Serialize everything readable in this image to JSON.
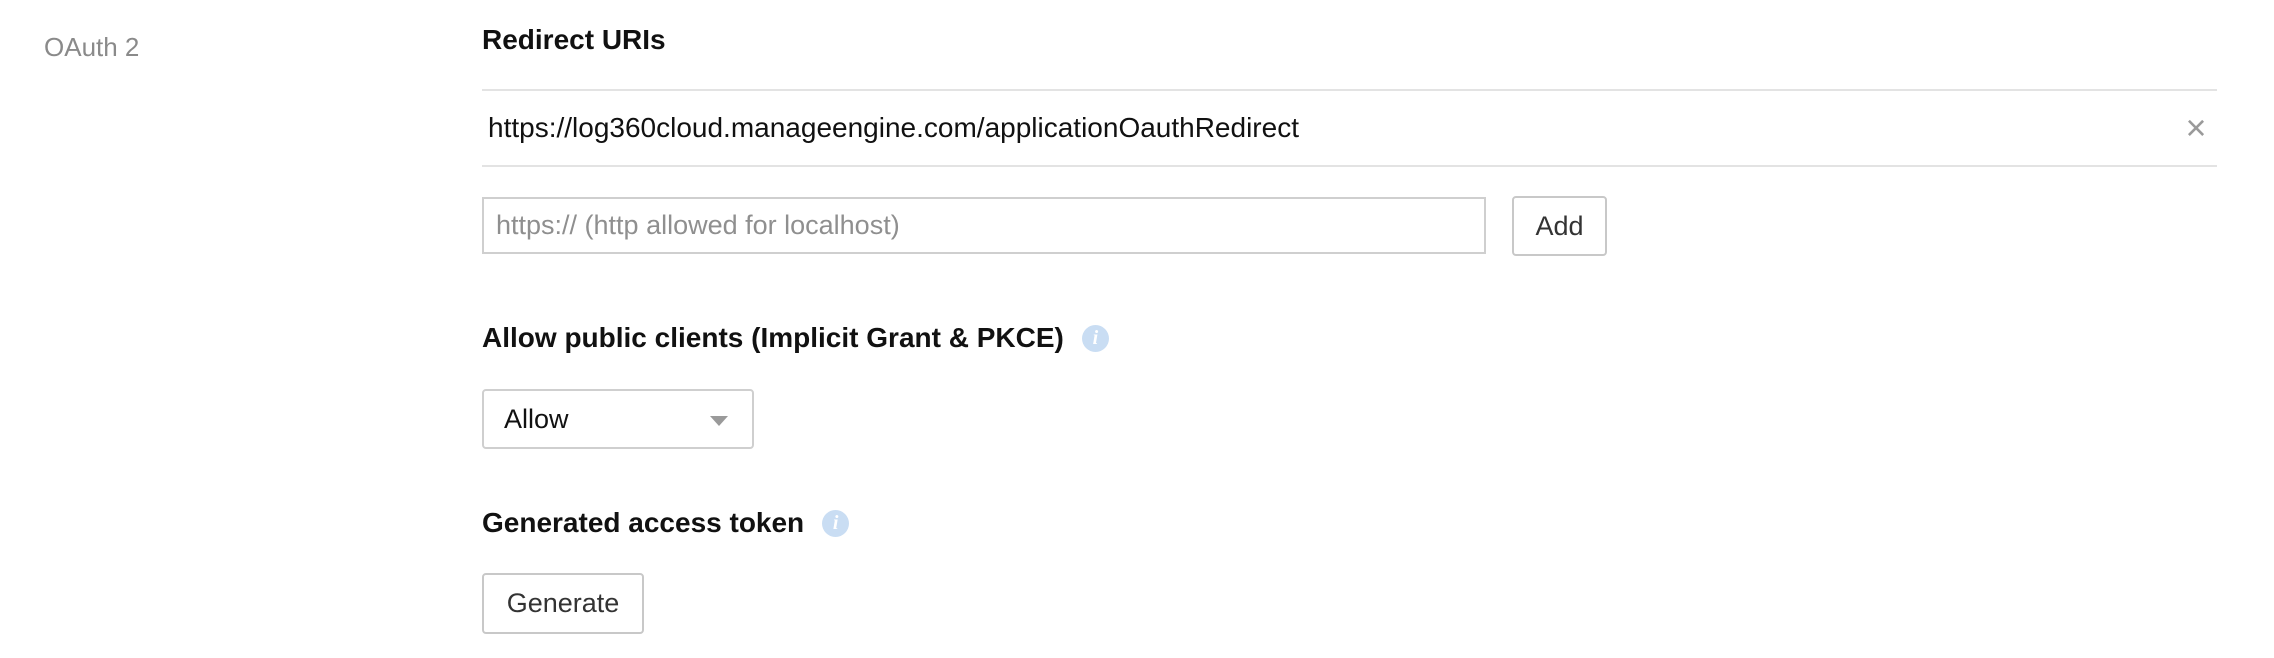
{
  "section": {
    "label": "OAuth 2"
  },
  "redirect": {
    "heading": "Redirect URIs",
    "uris": [
      "https://log360cloud.manageengine.com/applicationOauthRedirect"
    ],
    "remove_glyph": "×",
    "input_placeholder": "https:// (http allowed for localhost)",
    "input_value": "",
    "add_label": "Add"
  },
  "public_clients": {
    "heading": "Allow public clients (Implicit Grant & PKCE)",
    "info_icon": "info-icon",
    "selected": "Allow"
  },
  "access_token": {
    "heading": "Generated access token",
    "info_icon": "info-icon",
    "generate_label": "Generate"
  },
  "colors": {
    "info_icon_bg": "#c9ddf3",
    "border": "#cfcfcf",
    "muted_text": "#8a8a8a"
  }
}
